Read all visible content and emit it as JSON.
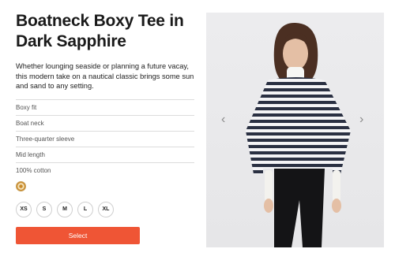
{
  "product": {
    "title": "Boatneck Boxy Tee in Dark Sapphire",
    "description": "Whether lounging seaside or planning a future vacay, this modern take on a nautical classic brings some sun and sand to any setting.",
    "features": [
      "Boxy fit",
      "Boat neck",
      "Three-quarter sleeve",
      "Mid length",
      "100% cotton"
    ],
    "color_swatch": {
      "icon": "sun-pattern-swatch-icon",
      "color": "#c98a2a"
    },
    "sizes": [
      "XS",
      "S",
      "M",
      "L",
      "XL"
    ],
    "select_label": "Select",
    "accent_color": "#ef5535"
  },
  "gallery": {
    "prev_icon": "‹",
    "next_icon": "›"
  }
}
